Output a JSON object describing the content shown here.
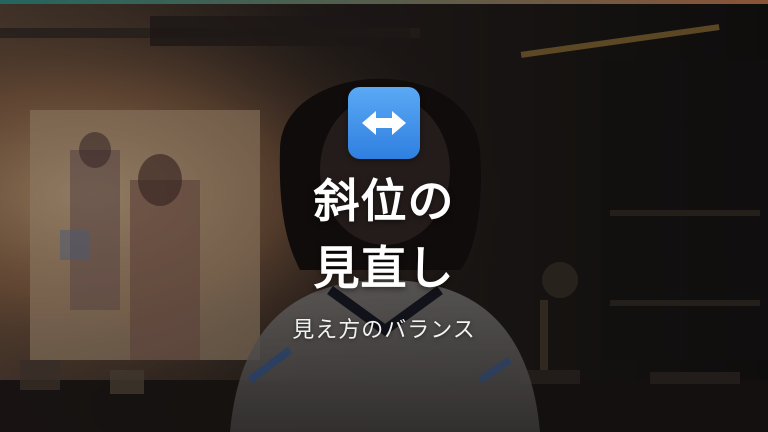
{
  "icon": "left-right-arrow-icon",
  "colors": {
    "accent_bar_start": "#3aa59a",
    "accent_bar_end": "#e0885a",
    "icon_bg": "#3d8ff0",
    "text": "#ffffff"
  },
  "title": {
    "line1": "斜位の",
    "line2": "見直し"
  },
  "subtitle": "見え方のバランス"
}
